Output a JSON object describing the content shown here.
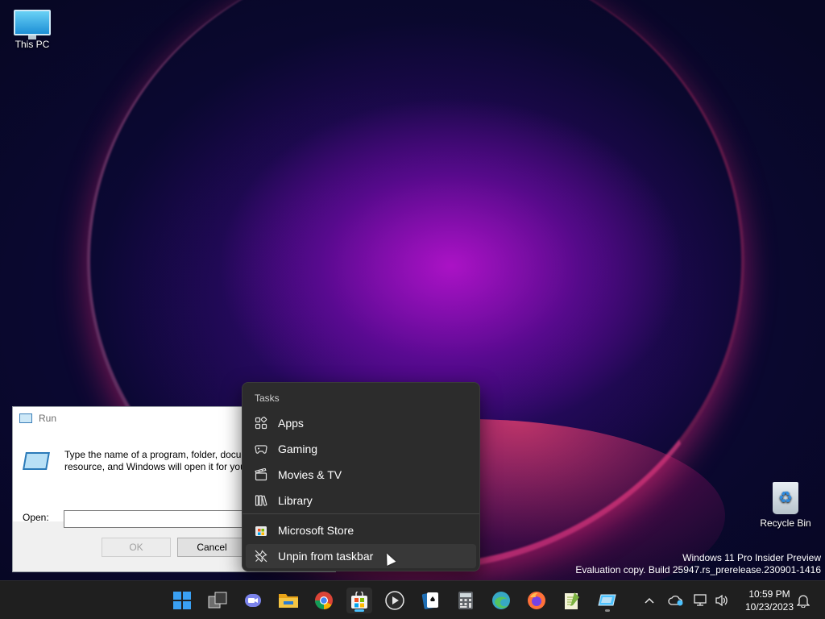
{
  "desktop": {
    "icons": [
      {
        "label": "This PC"
      },
      {
        "label": "Recycle Bin"
      }
    ],
    "watermark": {
      "line1": "Windows 11 Pro Insider Preview",
      "line2": "Evaluation copy. Build 25947.rs_prerelease.230901-1416"
    }
  },
  "run_dialog": {
    "title": "Run",
    "description": "Type the name of a program, folder, document, or Internet resource, and Windows will open it for you.",
    "open_label": "Open:",
    "open_value": "",
    "ok_label": "OK",
    "cancel_label": "Cancel"
  },
  "jump_list": {
    "header": "Tasks",
    "items": [
      {
        "label": "Apps",
        "icon": "apps-icon"
      },
      {
        "label": "Gaming",
        "icon": "gamepad-icon"
      },
      {
        "label": "Movies & TV",
        "icon": "clapperboard-icon"
      },
      {
        "label": "Library",
        "icon": "library-icon"
      }
    ],
    "app_items": [
      {
        "label": "Microsoft Store",
        "icon": "store-icon"
      },
      {
        "label": "Unpin from taskbar",
        "icon": "unpin-icon"
      }
    ]
  },
  "taskbar": {
    "apps": [
      {
        "name": "start",
        "color": "#3aa0f3"
      },
      {
        "name": "task-view",
        "color": "#cfcfcf"
      },
      {
        "name": "teams-chat",
        "color": "#7b83eb"
      },
      {
        "name": "file-explorer",
        "color": "#f5c543"
      },
      {
        "name": "chrome",
        "color": "#db4437"
      },
      {
        "name": "microsoft-store",
        "color": "#f25022"
      },
      {
        "name": "media-player",
        "color": "#e6e6e6"
      },
      {
        "name": "solitaire",
        "color": "#1f6fb5"
      },
      {
        "name": "calculator",
        "color": "#9aa0a6"
      },
      {
        "name": "edge",
        "color": "#37a8c4"
      },
      {
        "name": "firefox",
        "color": "#ff7139"
      },
      {
        "name": "notepad-plus",
        "color": "#7cb342"
      },
      {
        "name": "run",
        "color": "#4cc2ff"
      }
    ],
    "clock": {
      "time": "10:59 PM",
      "date": "10/23/2023"
    }
  }
}
